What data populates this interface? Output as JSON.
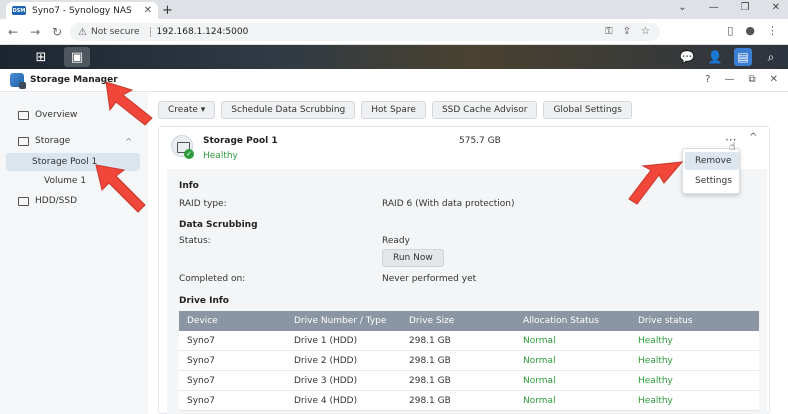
{
  "browser": {
    "tab_title": "Syno7 - Synology NAS",
    "tab_favicon": "DSM",
    "new_tab": "+",
    "not_secure": "Not secure",
    "url": "192.168.1.124:5000"
  },
  "window": {
    "title": "Storage Manager",
    "btn_help": "?",
    "btn_min": "—",
    "btn_max": "⧉",
    "btn_close": "✕"
  },
  "sidebar": {
    "items": [
      {
        "label": "Overview"
      },
      {
        "label": "Storage"
      },
      {
        "label": "Storage Pool 1"
      },
      {
        "label": "Volume 1"
      },
      {
        "label": "HDD/SSD"
      }
    ]
  },
  "toolbar": {
    "create": "Create ▾",
    "schedule": "Schedule Data Scrubbing",
    "hot_spare": "Hot Spare",
    "ssd_cache": "SSD Cache Advisor",
    "global": "Global Settings"
  },
  "pool": {
    "name": "Storage Pool 1",
    "status": "Healthy",
    "size": "575.7 GB",
    "more": "···",
    "collapse": "^"
  },
  "info": {
    "title": "Info",
    "raid_label": "RAID type:",
    "raid_value": "RAID 6 (With data protection)"
  },
  "scrubbing": {
    "title": "Data Scrubbing",
    "status_label": "Status:",
    "status_value": "Ready",
    "run_now": "Run Now",
    "completed_label": "Completed on:",
    "completed_value": "Never performed yet"
  },
  "drive_info": {
    "title": "Drive Info",
    "headers": [
      "Device",
      "Drive Number / Type",
      "Drive Size",
      "Allocation Status",
      "Drive status"
    ],
    "rows": [
      [
        "Syno7",
        "Drive 1 (HDD)",
        "298.1 GB",
        "Normal",
        "Healthy"
      ],
      [
        "Syno7",
        "Drive 2 (HDD)",
        "298.1 GB",
        "Normal",
        "Healthy"
      ],
      [
        "Syno7",
        "Drive 3 (HDD)",
        "298.1 GB",
        "Normal",
        "Healthy"
      ],
      [
        "Syno7",
        "Drive 4 (HDD)",
        "298.1 GB",
        "Normal",
        "Healthy"
      ]
    ]
  },
  "menu": {
    "remove": "Remove",
    "settings": "Settings"
  },
  "colors": {
    "healthy": "#2c9c3c",
    "annotation_arrow": "#f0473a",
    "table_header": "#8a96a3"
  }
}
